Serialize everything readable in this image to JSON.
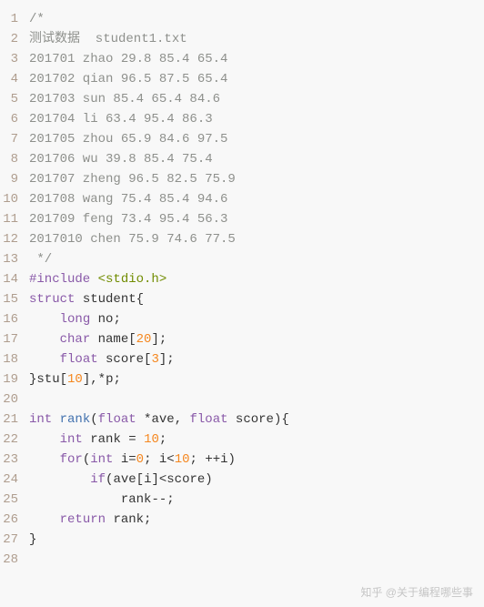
{
  "lines": [
    {
      "n": 1,
      "tokens": [
        {
          "c": "comment",
          "t": "/*"
        }
      ]
    },
    {
      "n": 2,
      "tokens": [
        {
          "c": "comment",
          "t": "测试数据  student1.txt"
        }
      ]
    },
    {
      "n": 3,
      "tokens": [
        {
          "c": "comment",
          "t": "201701 zhao 29.8 85.4 65.4"
        }
      ]
    },
    {
      "n": 4,
      "tokens": [
        {
          "c": "comment",
          "t": "201702 qian 96.5 87.5 65.4"
        }
      ]
    },
    {
      "n": 5,
      "tokens": [
        {
          "c": "comment",
          "t": "201703 sun 85.4 65.4 84.6"
        }
      ]
    },
    {
      "n": 6,
      "tokens": [
        {
          "c": "comment",
          "t": "201704 li 63.4 95.4 86.3"
        }
      ]
    },
    {
      "n": 7,
      "tokens": [
        {
          "c": "comment",
          "t": "201705 zhou 65.9 84.6 97.5"
        }
      ]
    },
    {
      "n": 8,
      "tokens": [
        {
          "c": "comment",
          "t": "201706 wu 39.8 85.4 75.4"
        }
      ]
    },
    {
      "n": 9,
      "tokens": [
        {
          "c": "comment",
          "t": "201707 zheng 96.5 82.5 75.9"
        }
      ]
    },
    {
      "n": 10,
      "tokens": [
        {
          "c": "comment",
          "t": "201708 wang 75.4 85.4 94.6"
        }
      ]
    },
    {
      "n": 11,
      "tokens": [
        {
          "c": "comment",
          "t": "201709 feng 73.4 95.4 56.3"
        }
      ]
    },
    {
      "n": 12,
      "tokens": [
        {
          "c": "comment",
          "t": "2017010 chen 75.9 74.6 77.5"
        }
      ]
    },
    {
      "n": 13,
      "tokens": [
        {
          "c": "comment",
          "t": " */"
        }
      ]
    },
    {
      "n": 14,
      "tokens": [
        {
          "c": "pp",
          "t": "#include "
        },
        {
          "c": "string",
          "t": "<stdio.h>"
        }
      ]
    },
    {
      "n": 15,
      "tokens": [
        {
          "c": "keyword",
          "t": "struct"
        },
        {
          "c": "punct",
          "t": " "
        },
        {
          "c": "ident",
          "t": "student"
        },
        {
          "c": "punct",
          "t": "{"
        }
      ]
    },
    {
      "n": 16,
      "tokens": [
        {
          "c": "punct",
          "t": "    "
        },
        {
          "c": "type",
          "t": "long"
        },
        {
          "c": "punct",
          "t": " "
        },
        {
          "c": "ident",
          "t": "no"
        },
        {
          "c": "punct",
          "t": ";"
        }
      ]
    },
    {
      "n": 17,
      "tokens": [
        {
          "c": "punct",
          "t": "    "
        },
        {
          "c": "type",
          "t": "char"
        },
        {
          "c": "punct",
          "t": " "
        },
        {
          "c": "ident",
          "t": "name"
        },
        {
          "c": "punct",
          "t": "["
        },
        {
          "c": "number",
          "t": "20"
        },
        {
          "c": "punct",
          "t": "];"
        }
      ]
    },
    {
      "n": 18,
      "tokens": [
        {
          "c": "punct",
          "t": "    "
        },
        {
          "c": "type",
          "t": "float"
        },
        {
          "c": "punct",
          "t": " "
        },
        {
          "c": "ident",
          "t": "score"
        },
        {
          "c": "punct",
          "t": "["
        },
        {
          "c": "number",
          "t": "3"
        },
        {
          "c": "punct",
          "t": "];"
        }
      ]
    },
    {
      "n": 19,
      "tokens": [
        {
          "c": "punct",
          "t": "}"
        },
        {
          "c": "ident",
          "t": "stu"
        },
        {
          "c": "punct",
          "t": "["
        },
        {
          "c": "number",
          "t": "10"
        },
        {
          "c": "punct",
          "t": "],*"
        },
        {
          "c": "ident",
          "t": "p"
        },
        {
          "c": "punct",
          "t": ";"
        }
      ]
    },
    {
      "n": 20,
      "tokens": []
    },
    {
      "n": 21,
      "tokens": [
        {
          "c": "type",
          "t": "int"
        },
        {
          "c": "punct",
          "t": " "
        },
        {
          "c": "func",
          "t": "rank"
        },
        {
          "c": "punct",
          "t": "("
        },
        {
          "c": "type",
          "t": "float"
        },
        {
          "c": "punct",
          "t": " *"
        },
        {
          "c": "ident",
          "t": "ave"
        },
        {
          "c": "punct",
          "t": ", "
        },
        {
          "c": "type",
          "t": "float"
        },
        {
          "c": "punct",
          "t": " "
        },
        {
          "c": "ident",
          "t": "score"
        },
        {
          "c": "punct",
          "t": "){"
        }
      ]
    },
    {
      "n": 22,
      "tokens": [
        {
          "c": "punct",
          "t": "    "
        },
        {
          "c": "type",
          "t": "int"
        },
        {
          "c": "punct",
          "t": " "
        },
        {
          "c": "ident",
          "t": "rank"
        },
        {
          "c": "punct",
          "t": " = "
        },
        {
          "c": "number",
          "t": "10"
        },
        {
          "c": "punct",
          "t": ";"
        }
      ]
    },
    {
      "n": 23,
      "tokens": [
        {
          "c": "punct",
          "t": "    "
        },
        {
          "c": "keyword",
          "t": "for"
        },
        {
          "c": "punct",
          "t": "("
        },
        {
          "c": "type",
          "t": "int"
        },
        {
          "c": "punct",
          "t": " "
        },
        {
          "c": "ident",
          "t": "i"
        },
        {
          "c": "punct",
          "t": "="
        },
        {
          "c": "number",
          "t": "0"
        },
        {
          "c": "punct",
          "t": "; "
        },
        {
          "c": "ident",
          "t": "i"
        },
        {
          "c": "punct",
          "t": "<"
        },
        {
          "c": "number",
          "t": "10"
        },
        {
          "c": "punct",
          "t": "; ++"
        },
        {
          "c": "ident",
          "t": "i"
        },
        {
          "c": "punct",
          "t": ")"
        }
      ]
    },
    {
      "n": 24,
      "tokens": [
        {
          "c": "punct",
          "t": "        "
        },
        {
          "c": "keyword",
          "t": "if"
        },
        {
          "c": "punct",
          "t": "("
        },
        {
          "c": "ident",
          "t": "ave"
        },
        {
          "c": "punct",
          "t": "["
        },
        {
          "c": "ident",
          "t": "i"
        },
        {
          "c": "punct",
          "t": "]<"
        },
        {
          "c": "ident",
          "t": "score"
        },
        {
          "c": "punct",
          "t": ")"
        }
      ]
    },
    {
      "n": 25,
      "tokens": [
        {
          "c": "punct",
          "t": "            "
        },
        {
          "c": "ident",
          "t": "rank"
        },
        {
          "c": "punct",
          "t": "--;"
        }
      ]
    },
    {
      "n": 26,
      "tokens": [
        {
          "c": "punct",
          "t": "    "
        },
        {
          "c": "keyword",
          "t": "return"
        },
        {
          "c": "punct",
          "t": " "
        },
        {
          "c": "ident",
          "t": "rank"
        },
        {
          "c": "punct",
          "t": ";"
        }
      ]
    },
    {
      "n": 27,
      "tokens": [
        {
          "c": "punct",
          "t": "}"
        }
      ]
    },
    {
      "n": 28,
      "tokens": []
    }
  ],
  "watermark": "知乎 @关于编程哪些事"
}
